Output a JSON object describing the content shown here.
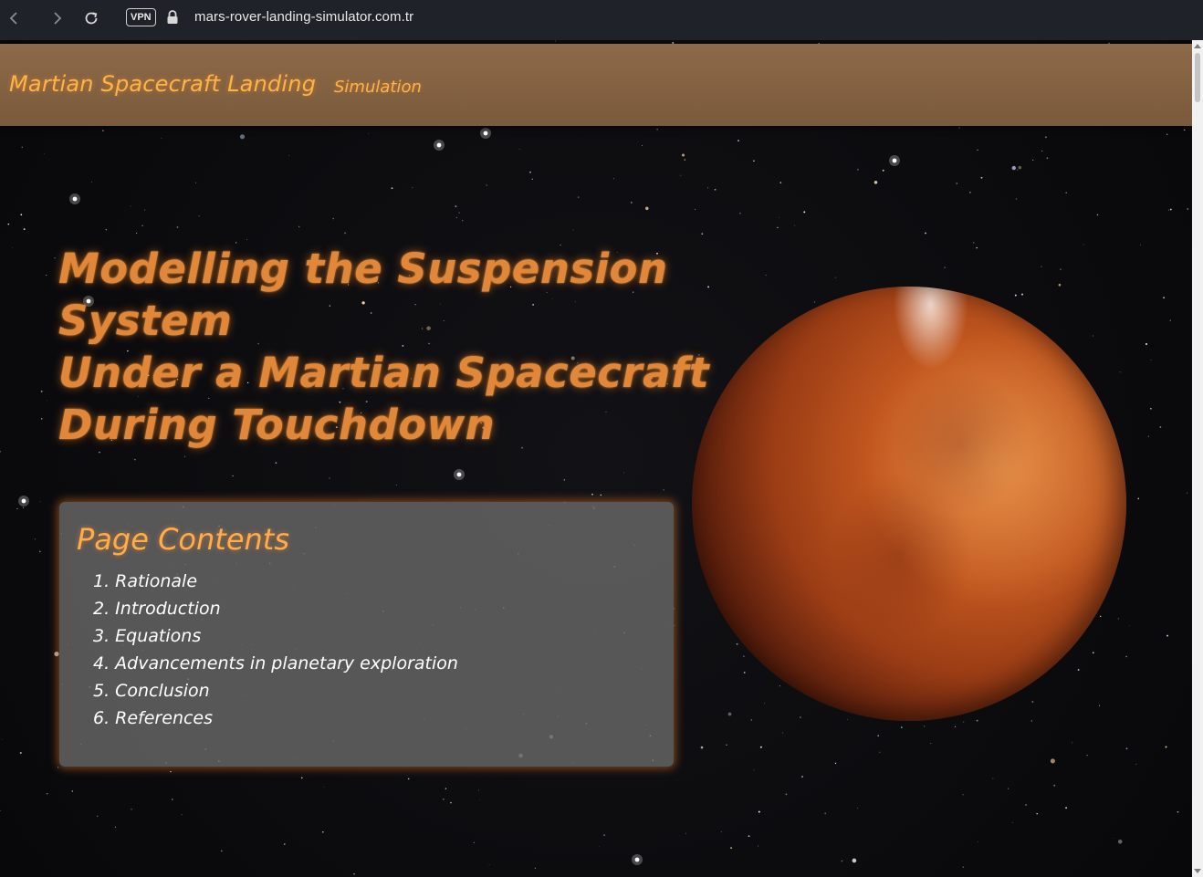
{
  "browser": {
    "url": "mars-rover-landing-simulator.com.tr",
    "vpn_label": "VPN"
  },
  "site": {
    "title": "Martian Spacecraft Landing",
    "nav": [
      "Simulation"
    ]
  },
  "hero": {
    "title_lines": [
      "Modelling the Suspension",
      "System",
      "Under a Martian Spacecraft",
      "During Touchdown"
    ]
  },
  "contents": {
    "heading": "Page Contents",
    "items": [
      "1. Rationale",
      "2. Introduction",
      "3. Equations",
      "4. Advancements in planetary exploration",
      "5. Conclusion",
      "6. References"
    ]
  },
  "colors": {
    "header_bg": "#8d6a49",
    "accent_orange": "#ffb347",
    "hero_orange": "#e1873a",
    "browser_bar": "#1f2228"
  },
  "icons": [
    "back-arrow-icon",
    "forward-arrow-icon",
    "reload-icon",
    "lock-icon",
    "mars-planet-image"
  ]
}
